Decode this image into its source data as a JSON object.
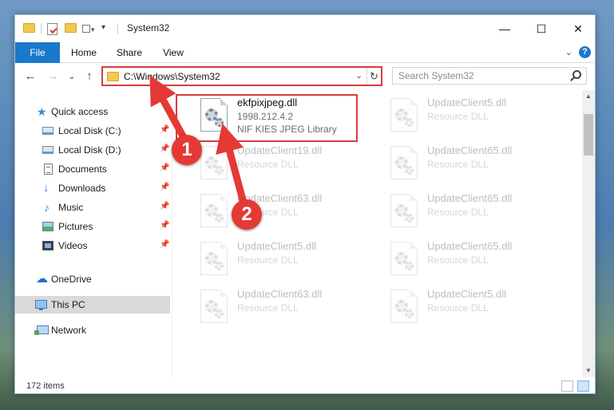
{
  "window": {
    "title": "System32",
    "controls": {
      "minimize": "—",
      "maximize": "☐",
      "close": "✕"
    }
  },
  "ribbon": {
    "tabs": [
      "File",
      "Home",
      "Share",
      "View"
    ],
    "expand": "⌄",
    "help": "?"
  },
  "nav": {
    "back": "←",
    "forward": "→",
    "recent": "⌄",
    "up": "↑",
    "address": "C:\\Windows\\System32",
    "dropdown": "⌄",
    "refresh": "↻",
    "search_placeholder": "Search System32"
  },
  "sidebar": {
    "items": [
      {
        "label": "Quick access",
        "icon": "star-icon",
        "pinned": false
      },
      {
        "label": "Local Disk (C:)",
        "icon": "disk-icon",
        "pinned": true
      },
      {
        "label": "Local Disk (D:)",
        "icon": "disk-icon",
        "pinned": true
      },
      {
        "label": "Documents",
        "icon": "document-icon",
        "pinned": true
      },
      {
        "label": "Downloads",
        "icon": "download-icon",
        "pinned": true
      },
      {
        "label": "Music",
        "icon": "music-icon",
        "pinned": true
      },
      {
        "label": "Pictures",
        "icon": "pictures-icon",
        "pinned": true
      },
      {
        "label": "Videos",
        "icon": "videos-icon",
        "pinned": true
      },
      {
        "label": "OneDrive",
        "icon": "cloud-icon",
        "pinned": false
      },
      {
        "label": "This PC",
        "icon": "computer-icon",
        "pinned": false,
        "selected": true
      },
      {
        "label": "Network",
        "icon": "network-icon",
        "pinned": false
      }
    ],
    "pin_glyph": "📌"
  },
  "files": [
    {
      "name": "ekfpixjpeg.dll",
      "version": "1998.212.4.2",
      "description": "NIF KIES JPEG Library",
      "highlighted": true
    },
    {
      "name": "UpdateClient5.dll",
      "description": "Resource DLL"
    },
    {
      "name": "UpdateClient19.dll",
      "description": "Resource DLL"
    },
    {
      "name": "UpdateClient65.dll",
      "description": "Resource DLL"
    },
    {
      "name": "UpdateClient63.dll",
      "description": "Resource DLL"
    },
    {
      "name": "UpdateClient65.dll",
      "description": "Resource DLL"
    },
    {
      "name": "UpdateClient5.dll",
      "description": "Resource DLL"
    },
    {
      "name": "UpdateClient65.dll",
      "description": "Resource DLL"
    },
    {
      "name": "UpdateClient63.dll",
      "description": "Resource DLL"
    },
    {
      "name": "UpdateClient5.dll",
      "description": "Resource DLL"
    }
  ],
  "status": {
    "item_count": "172 items"
  },
  "annotations": [
    {
      "label": "1"
    },
    {
      "label": "2"
    }
  ],
  "colors": {
    "accent": "#1979ca",
    "highlight_box": "#dc3b3b",
    "annotation": "#e53935"
  }
}
